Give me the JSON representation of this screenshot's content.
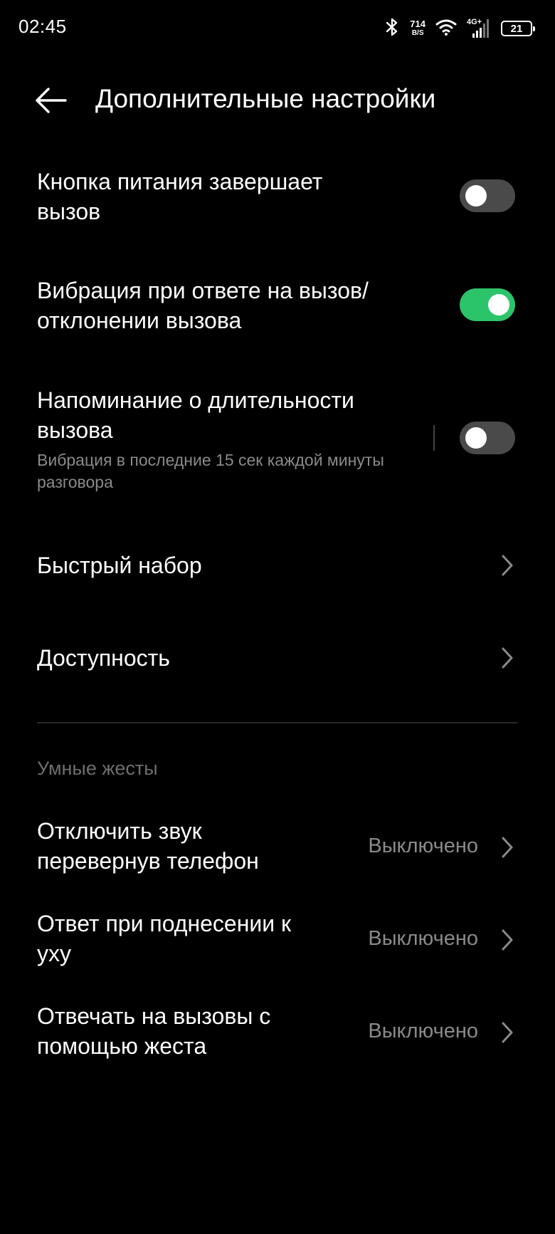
{
  "status_bar": {
    "time": "02:45",
    "net_speed": "714",
    "net_speed_unit": "B/S",
    "network_type": "4G+",
    "battery_level": "21",
    "icons": [
      "bluetooth-icon",
      "wifi-icon",
      "cellular-signal-icon",
      "battery-icon"
    ]
  },
  "header": {
    "title": "Дополнительные настройки",
    "back_icon": "back-arrow-icon"
  },
  "settings": {
    "power_button_ends_call": {
      "label": "Кнопка питания завершает вызов",
      "enabled": false
    },
    "vibrate_on_answer": {
      "label": "Вибрация при ответе на вызов/ отклонении вызова",
      "enabled": true
    },
    "call_duration_reminder": {
      "label": "Напоминание о длительности вызова",
      "description": "Вибрация в последние 15 сек каждой минуты разговора",
      "enabled": false
    },
    "speed_dial": {
      "label": "Быстрый набор"
    },
    "accessibility": {
      "label": "Доступность"
    }
  },
  "smart_gestures": {
    "header": "Умные жесты",
    "items": [
      {
        "label": "Отключить звук перевернув телефон",
        "value": "Выключено"
      },
      {
        "label": "Ответ при поднесении к уху",
        "value": "Выключено"
      },
      {
        "label": "Отвечать на вызовы с помощью жеста",
        "value": "Выключено"
      }
    ]
  },
  "colors": {
    "background": "#000000",
    "toggle_on": "#2bc46a",
    "toggle_off": "#4a4a4a",
    "secondary_text": "#8a8a8a"
  }
}
